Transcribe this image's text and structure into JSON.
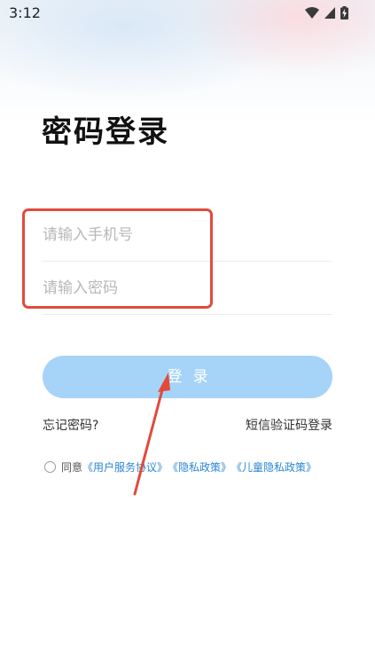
{
  "status_bar": {
    "time": "3:12",
    "icons": [
      "wifi-icon",
      "signal-icon",
      "battery-charging-icon"
    ]
  },
  "title": "密码登录",
  "form": {
    "phone_placeholder": "请输入手机号",
    "password_placeholder": "请输入密码",
    "login_label": "登录"
  },
  "links": {
    "forgot_password": "忘记密码?",
    "sms_login": "短信验证码登录"
  },
  "agreement": {
    "prefix": "同意",
    "user_agreement": "《用户服务协议》",
    "privacy_policy": "《隐私政策》",
    "children_privacy": "《儿童隐私政策》",
    "checked": false
  },
  "colors": {
    "login_button": "#a6d3f8",
    "link": "#2a86d6",
    "annotation": "#e24a3b"
  }
}
